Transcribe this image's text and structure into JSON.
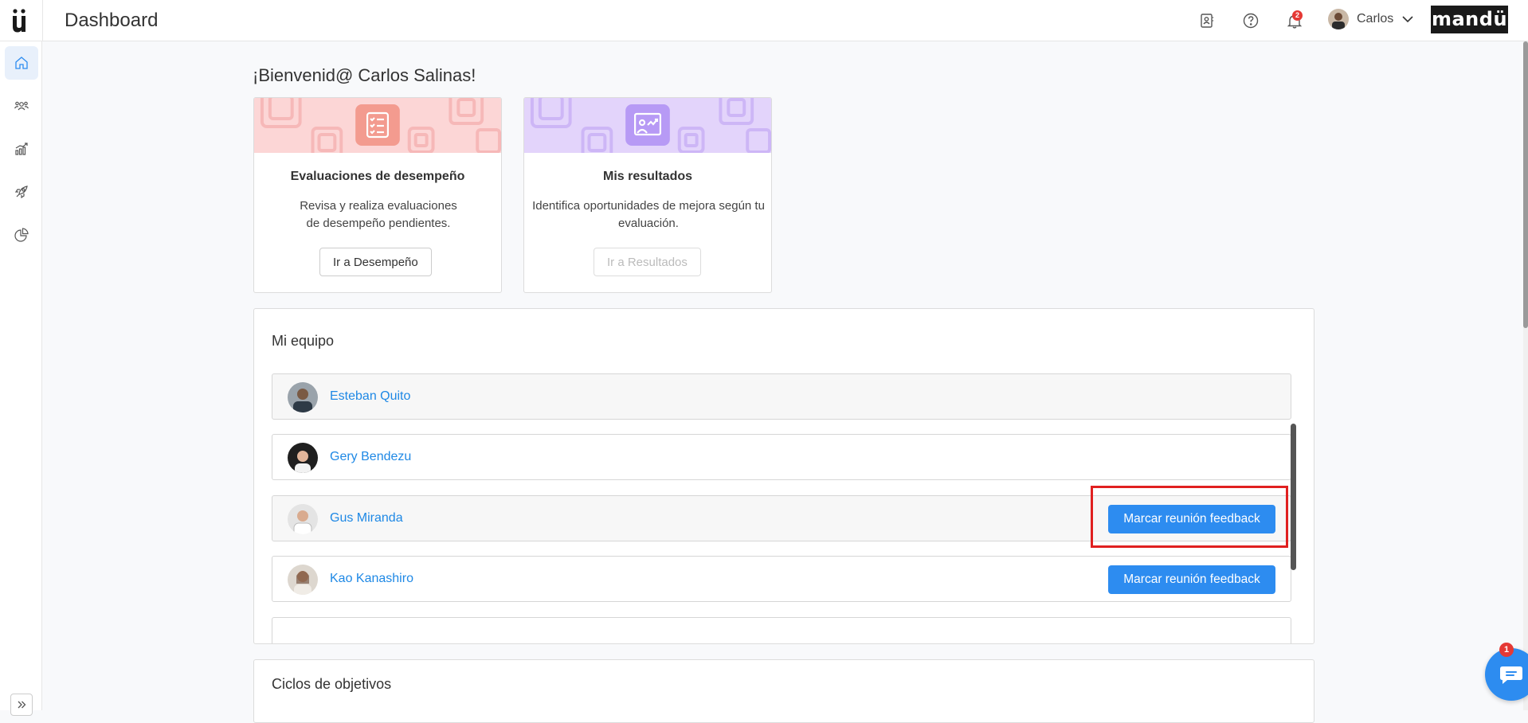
{
  "header": {
    "title": "Dashboard",
    "user_name": "Carlos",
    "brand": "mandü",
    "notification_count": "2",
    "icons": [
      "contact-card-icon",
      "help-icon",
      "bell-icon",
      "chevron-down-icon"
    ]
  },
  "sidebar": {
    "items": [
      {
        "name": "home",
        "icon": "home-icon",
        "active": true
      },
      {
        "name": "team",
        "icon": "users-icon"
      },
      {
        "name": "performance",
        "icon": "chart-icon"
      },
      {
        "name": "objectives",
        "icon": "rocket-icon"
      },
      {
        "name": "results",
        "icon": "pie-chart-icon"
      }
    ],
    "expand_icon": "double-chevron-right-icon"
  },
  "welcome": "¡Bienvenid@ Carlos Salinas!",
  "cards": [
    {
      "title": "Evaluaciones de desempeño",
      "desc_line1": "Revisa y realiza evaluaciones",
      "desc_line2": "de desempeño pendientes.",
      "button": "Ir a Desempeño",
      "color": "#fcd6d6"
    },
    {
      "title": "Mis resultados",
      "desc_line1": "Identifica oportunidades de mejora según tu",
      "desc_line2": "evaluación.",
      "button": "Ir a Resultados",
      "color": "#e3d4fb"
    }
  ],
  "team": {
    "title": "Mi equipo",
    "members": [
      {
        "name": "Esteban Quito",
        "action": ""
      },
      {
        "name": "Gery Bendezu",
        "action": ""
      },
      {
        "name": "Gus Miranda",
        "action": "Marcar reunión feedback"
      },
      {
        "name": "Kao Kanashiro",
        "action": "Marcar reunión feedback"
      }
    ]
  },
  "objectives": {
    "title": "Ciclos de objetivos"
  },
  "chat": {
    "badge": "1",
    "icon": "chat-icon"
  },
  "colors": {
    "accent": "#2d8cf0",
    "link": "#1e88e5",
    "highlight": "#e02020"
  }
}
